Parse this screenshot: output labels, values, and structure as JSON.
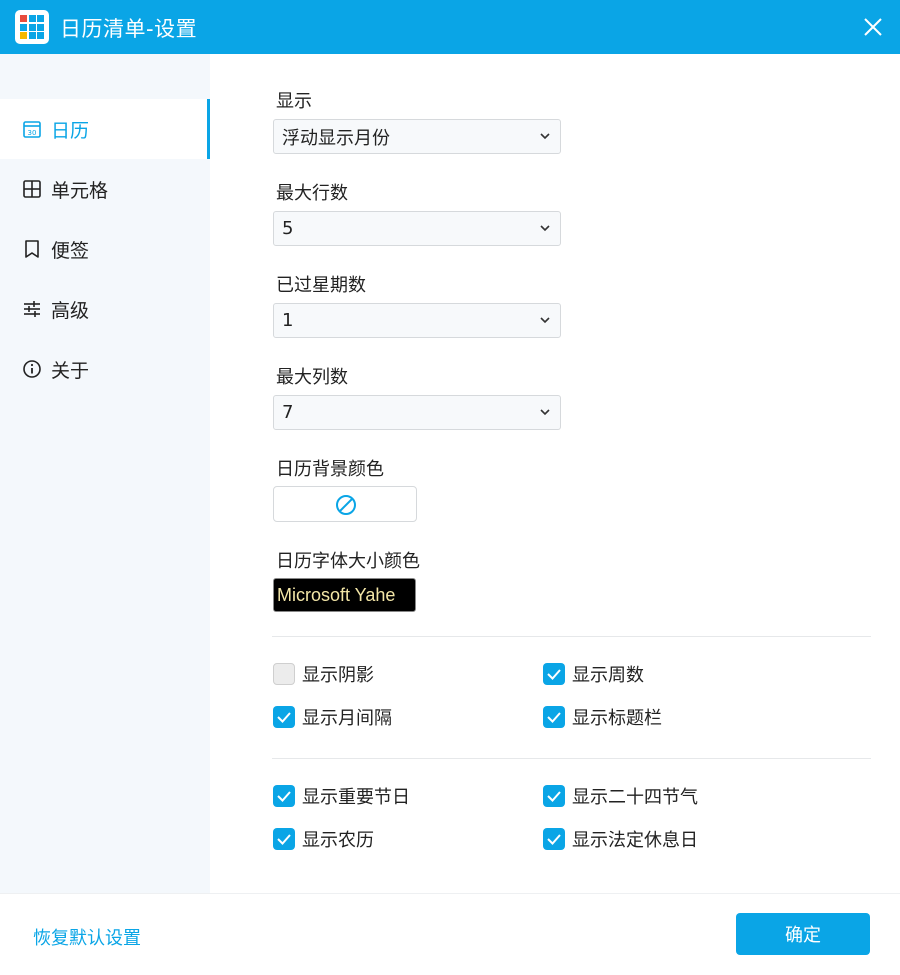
{
  "window": {
    "title": "日历清单-设置"
  },
  "icons": {
    "app": "app-grid-icon",
    "close": "close-icon"
  },
  "colors": {
    "accent": "#0aa5e6",
    "sidebar_bg": "#f4f8fc",
    "font_preview_bg": "#000000",
    "font_preview_color": "#f3e6a7"
  },
  "sidebar": {
    "items": [
      {
        "label": "日历",
        "icon": "calendar-icon",
        "active": true
      },
      {
        "label": "单元格",
        "icon": "grid-icon",
        "active": false
      },
      {
        "label": "便签",
        "icon": "bookmark-icon",
        "active": false
      },
      {
        "label": "高级",
        "icon": "sliders-icon",
        "active": false
      },
      {
        "label": "关于",
        "icon": "info-icon",
        "active": false
      }
    ]
  },
  "settings": {
    "display": {
      "label": "显示",
      "value": "浮动显示月份"
    },
    "max_rows": {
      "label": "最大行数",
      "value": "5"
    },
    "past_weeks": {
      "label": "已过星期数",
      "value": "1"
    },
    "max_cols": {
      "label": "最大列数",
      "value": "7"
    },
    "bg_color": {
      "label": "日历背景颜色",
      "icon": "no-color-icon"
    },
    "font": {
      "label": "日历字体大小颜色",
      "value": "Microsoft Yahe"
    }
  },
  "checkboxes": {
    "show_shadow": {
      "label": "显示阴影",
      "checked": false
    },
    "show_week_num": {
      "label": "显示周数",
      "checked": true
    },
    "show_month_gap": {
      "label": "显示月间隔",
      "checked": true
    },
    "show_titlebar": {
      "label": "显示标题栏",
      "checked": true
    },
    "show_festivals": {
      "label": "显示重要节日",
      "checked": true
    },
    "show_solar_terms": {
      "label": "显示二十四节气",
      "checked": true
    },
    "show_lunar": {
      "label": "显示农历",
      "checked": true
    },
    "show_holidays": {
      "label": "显示法定休息日",
      "checked": true
    }
  },
  "footer": {
    "reset_label": "恢复默认设置",
    "ok_label": "确定"
  }
}
